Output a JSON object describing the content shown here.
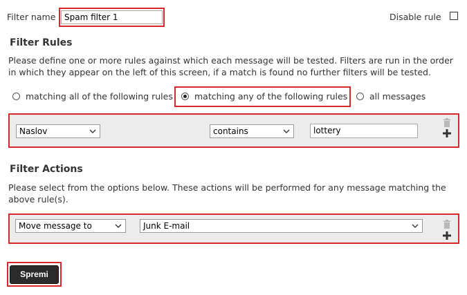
{
  "filter_name": {
    "label": "Filter name",
    "value": "Spam filter 1"
  },
  "disable_rule": {
    "label": "Disable rule",
    "checked": false
  },
  "filter_rules": {
    "title": "Filter Rules",
    "description": "Please define one or more rules against which each message will be tested. Filters are run in the order in which they appear on the left of this screen, if a match is found no further filters will be tested.",
    "match_options": [
      {
        "label": "matching all of the following rules",
        "selected": false
      },
      {
        "label": "matching any of the following rules",
        "selected": true
      },
      {
        "label": "all messages",
        "selected": false
      }
    ],
    "rule": {
      "header": "Naslov",
      "operator": "contains",
      "value": "lottery"
    }
  },
  "filter_actions": {
    "title": "Filter Actions",
    "description": "Please select from the options below. These actions will be performed for any message matching the above rule(s).",
    "action": {
      "type": "Move message to",
      "target": "Junk E-mail"
    }
  },
  "save_button": {
    "label": "Spremi"
  },
  "colors": {
    "highlight": "#d8262c",
    "row_bg": "#ececec",
    "button_bg": "#2b2b2b"
  },
  "icons": {
    "delete": "trash-icon",
    "add": "plus-icon",
    "dropdown": "chevron-down-icon"
  }
}
